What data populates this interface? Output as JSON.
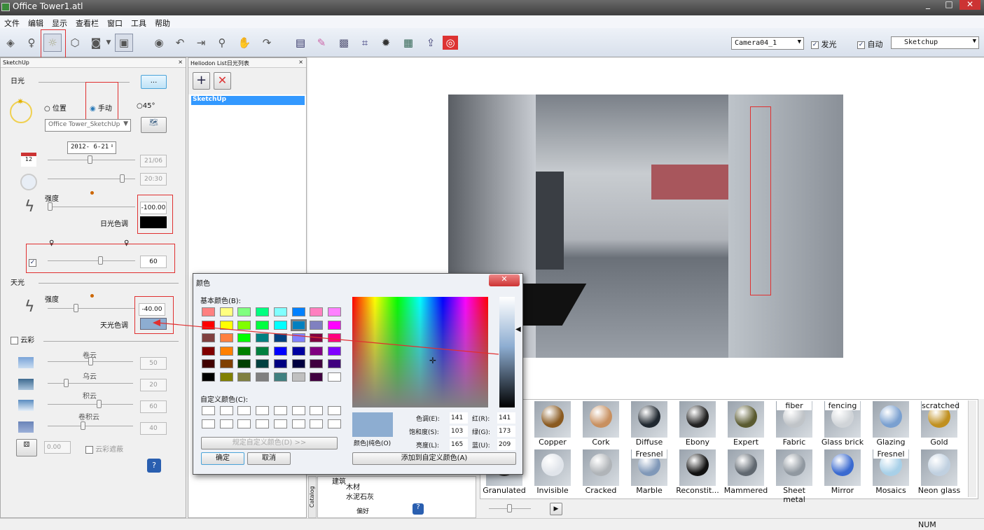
{
  "window": {
    "title": "Office Tower1.atl",
    "controls": [
      "_",
      "□",
      "✕"
    ]
  },
  "menu": [
    "文件",
    "编辑",
    "显示",
    "查看栏",
    "窗口",
    "工具",
    "帮助"
  ],
  "toolbar": {
    "camera": "Camera04_1",
    "glow_label": "发光",
    "glow_checked": true,
    "auto_label": "自动",
    "auto_checked": true,
    "style": "Sketchup"
  },
  "sun_panel": {
    "title": "SketchUp",
    "section_sun": "日光",
    "more_button": "...",
    "radio_position": "位置",
    "radio_manual": "手动",
    "radio_45": "45°",
    "selected_radio": "手动",
    "location": "Office Tower_SketchUp",
    "date": "2012- 6-21",
    "date_value": "21/06",
    "time_value": "20:30",
    "intensity_label": "强度",
    "sun_intensity": "-100.00",
    "sun_color_label": "日光色调",
    "sun_color": "#000000",
    "shadow_checked": true,
    "shadow_value": "60",
    "section_sky": "天光",
    "sky_intensity_label": "强度",
    "sky_intensity": "-40.00",
    "sky_color_label": "天光色调",
    "sky_color": "#8dadd1",
    "clouds_label": "云彩",
    "clouds_checked": false,
    "clouds": [
      {
        "label": "卷云",
        "value": "50"
      },
      {
        "label": "乌云",
        "value": "20"
      },
      {
        "label": "积云",
        "value": "60"
      },
      {
        "label": "卷积云",
        "value": "40"
      }
    ],
    "cloud_offset": "0.00",
    "cloud_mask_label": "云彩遮蔽"
  },
  "heliodon": {
    "title": "Heliodon List日光列表",
    "items": [
      "SketchUp"
    ],
    "selected": "SketchUp"
  },
  "color_dialog": {
    "title": "颜色",
    "basic_label": "基本颜色(B):",
    "custom_label": "自定义颜色(C):",
    "define_custom": "规定自定义颜色(D) >>",
    "ok": "确定",
    "cancel": "取消",
    "solid_label": "颜色|纯色(O)",
    "hue_label": "色调(E):",
    "hue": "141",
    "sat_label": "饱和度(S):",
    "sat": "103",
    "lum_label": "亮度(L):",
    "lum": "165",
    "red_label": "红(R):",
    "red": "141",
    "green_label": "绿(G):",
    "green": "173",
    "blue_label": "蓝(U):",
    "blue": "209",
    "add_custom": "添加到自定义颜色(A)",
    "basic_colors": [
      "#ff8080",
      "#ffff80",
      "#80ff80",
      "#00ff80",
      "#80ffff",
      "#0080ff",
      "#ff80c0",
      "#ff80ff",
      "#ff0000",
      "#ffff00",
      "#80ff00",
      "#00ff40",
      "#00ffff",
      "#0080c0",
      "#8080c0",
      "#ff00ff",
      "#804040",
      "#ff8040",
      "#00ff00",
      "#008080",
      "#004080",
      "#8080ff",
      "#800040",
      "#ff0080",
      "#800000",
      "#ff8000",
      "#008000",
      "#008040",
      "#0000ff",
      "#0000a0",
      "#800080",
      "#8000ff",
      "#400000",
      "#804000",
      "#004000",
      "#004040",
      "#000080",
      "#000040",
      "#400040",
      "#400080",
      "#000000",
      "#808000",
      "#808040",
      "#808080",
      "#408080",
      "#c0c0c0",
      "#400040",
      "#ffffff"
    ],
    "selected_basic": "#0080c0",
    "current_color": "#8dadd1"
  },
  "materials": {
    "row1": [
      {
        "name": "Copper",
        "top": ""
      },
      {
        "name": "Cork",
        "top": ""
      },
      {
        "name": "Diffuse",
        "top": ""
      },
      {
        "name": "Ebony",
        "top": ""
      },
      {
        "name": "Expert",
        "top": ""
      },
      {
        "name": "Fabric",
        "top": "fiber"
      },
      {
        "name": "Glass brick",
        "top": "fencing"
      },
      {
        "name": "Glazing",
        "top": ""
      },
      {
        "name": "Gold",
        "top": "scratched"
      }
    ],
    "row2": [
      {
        "name": "Granulated",
        "top": ""
      },
      {
        "name": "Invisible",
        "top": ""
      },
      {
        "name": "Cracked",
        "top": ""
      },
      {
        "name": "Marble",
        "top": "Fresnel"
      },
      {
        "name": "Reconstit...",
        "top": ""
      },
      {
        "name": "Mammered",
        "top": ""
      },
      {
        "name": "Sheet metal",
        "top": ""
      },
      {
        "name": "Mirror",
        "top": ""
      },
      {
        "name": "Mosaics",
        "top": "Fresnel"
      },
      {
        "name": "Neon glass",
        "top": ""
      }
    ]
  },
  "catalog": {
    "tab": "Catalog",
    "tree": [
      "建筑",
      "木材",
      "水泥石灰"
    ],
    "favorites": "偏好"
  },
  "status": {
    "num": "NUM"
  }
}
